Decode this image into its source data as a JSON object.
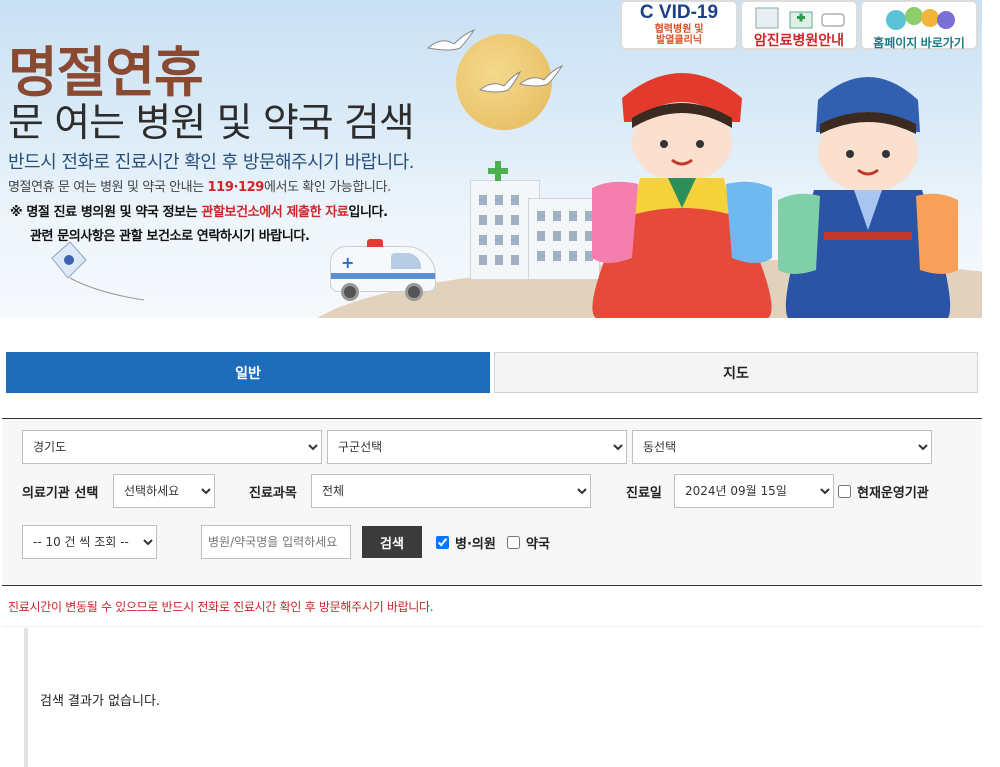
{
  "banner": {
    "title_main": "명절연휴",
    "title_sub": "문 여는 병원 및 약국 검색",
    "line1": "반드시 전화로 진료시간 확인 후 방문해주시기 바랍니다.",
    "line2_pre": "명절연휴 문 여는 병원 및 약국 안내는 ",
    "line2_red": "119·129",
    "line2_post": "에서도 확인 가능합니다.",
    "line3_pre": "※ 명절 진료 병의원 및 약국 정보는 ",
    "line3_red": "관할보건소에서 제출한 자료",
    "line3_post": "입니다.",
    "line4": "관련 문의사항은 관할 보건소로 연락하시기 바랍니다."
  },
  "top_buttons": {
    "covid_title": "C VID-19",
    "covid_line1": "협력병원 및",
    "covid_line2": "발열클리닉",
    "cancer_label": "암진료병원안내",
    "home_label": "홈페이지 바로가기"
  },
  "tabs": [
    {
      "label": "일반",
      "active": true
    },
    {
      "label": "지도",
      "active": false
    }
  ],
  "filters": {
    "province": "경기도",
    "district": "구군선택",
    "dong": "동선택",
    "institution_label": "의료기관 선택",
    "institution_value": "선택하세요",
    "department_label": "진료과목",
    "department_value": "전체",
    "date_label": "진료일",
    "date_value": "2024년 09월 15일",
    "operating_label": "현재운영기관",
    "page_size": "-- 10 건 씩 조회 --",
    "name_placeholder": "병원/약국명을 입력하세요",
    "search_label": "검색",
    "hospital_label": "병·의원",
    "pharmacy_label": "약국"
  },
  "notice": "진료시간이 변동될 수 있으므로 반드시 전화로 진료시간 확인 후 방문해주시기 바랍니다.",
  "result_text": "검색 결과가 없습니다.",
  "colors": {
    "tab_active": "#1e6dbb",
    "notice_red": "#c6262a",
    "title_brown": "#8a4a32"
  }
}
